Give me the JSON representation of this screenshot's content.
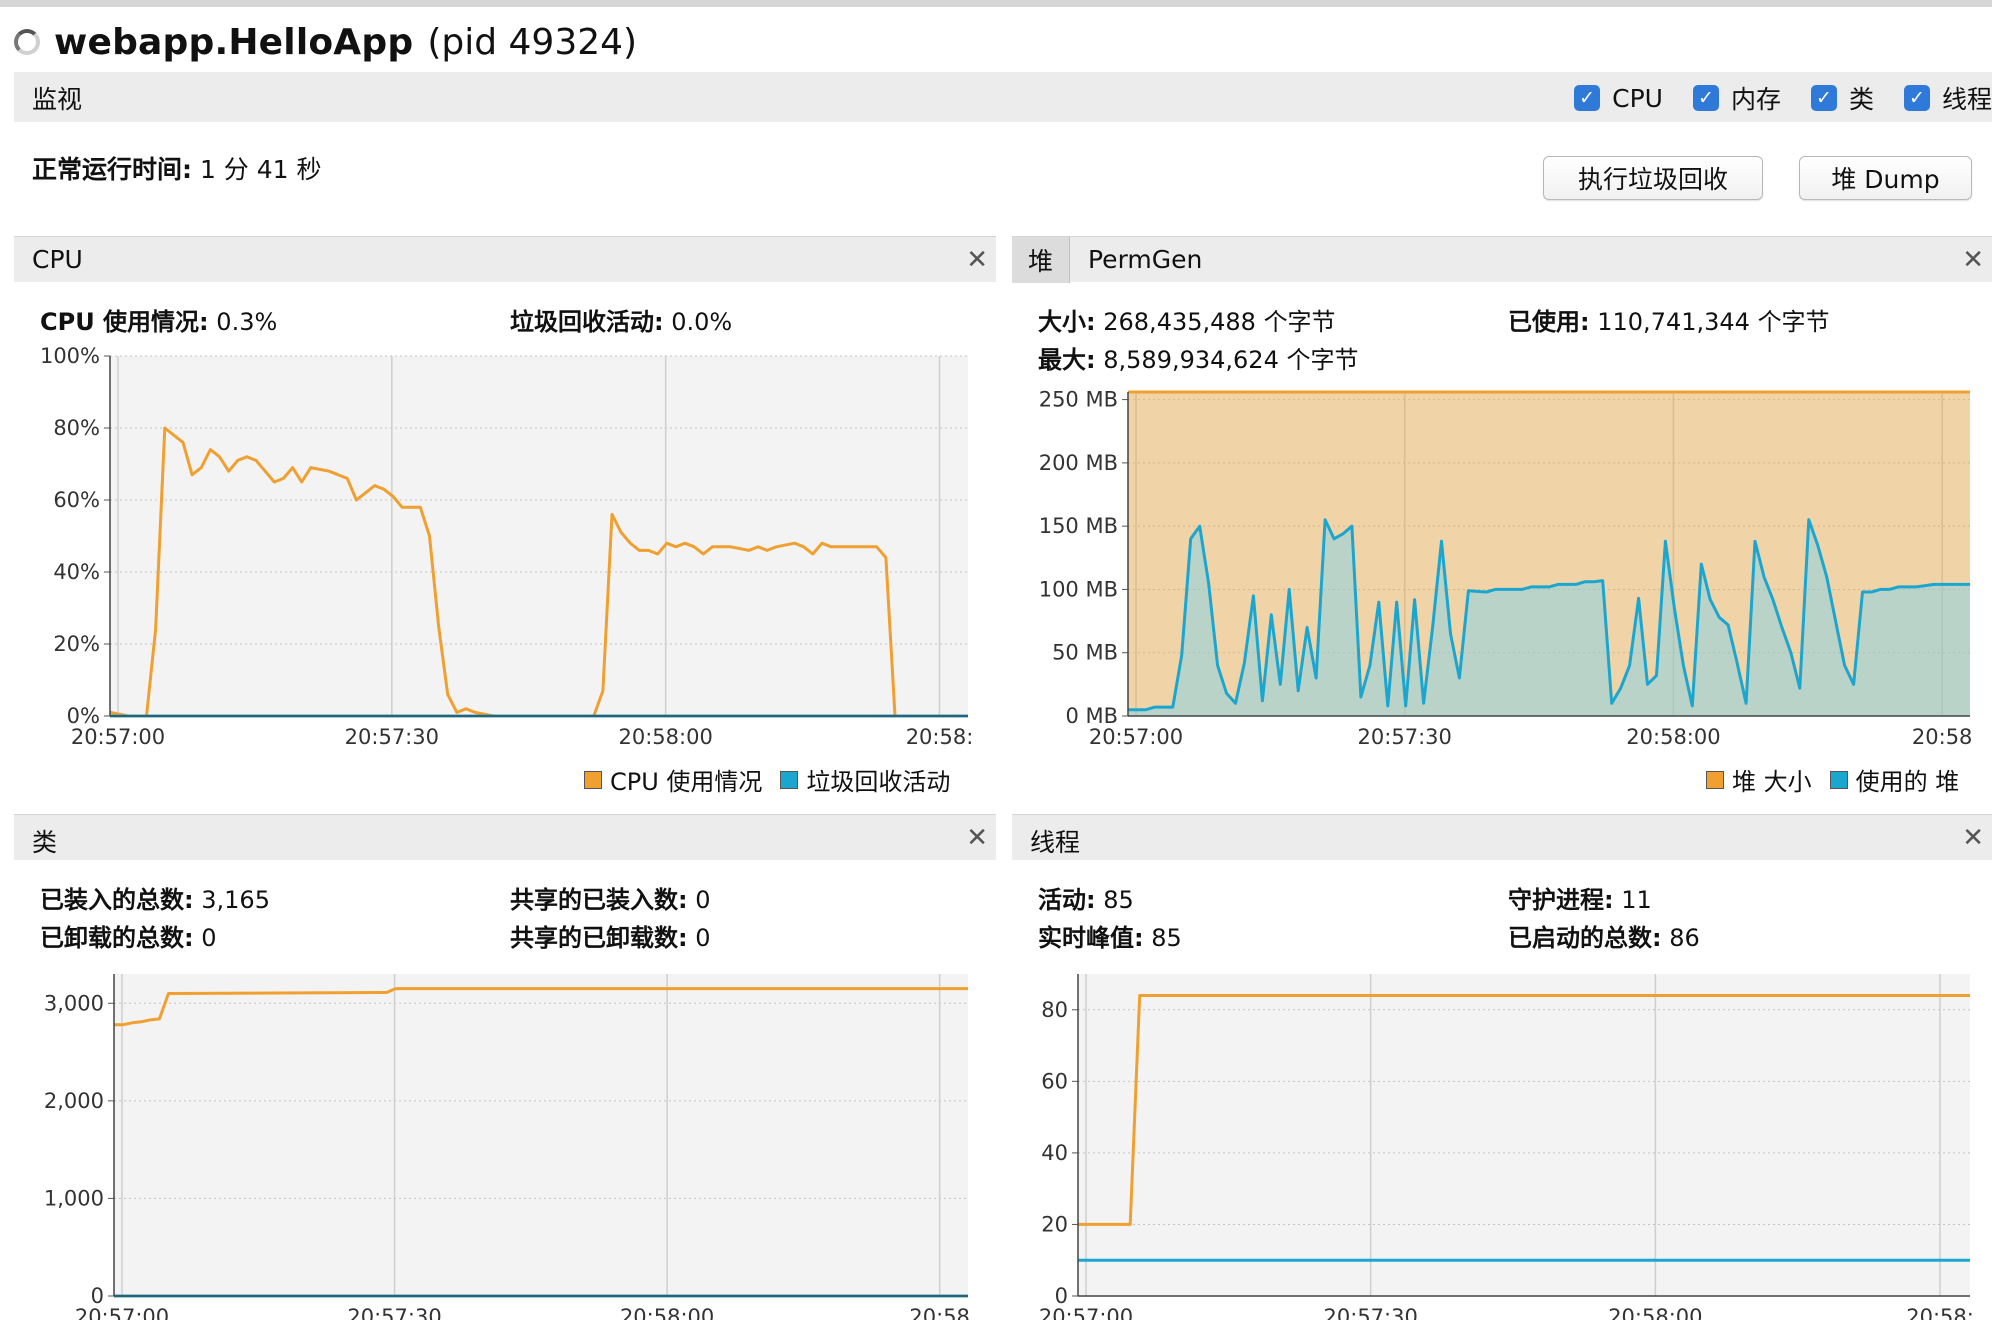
{
  "window": {
    "title": "webapp.HelloApp",
    "pid": "(pid 49324)"
  },
  "monitor": {
    "label": "监视",
    "checks": [
      {
        "label": "CPU",
        "checked": true
      },
      {
        "label": "内存",
        "checked": true
      },
      {
        "label": "类",
        "checked": true
      },
      {
        "label": "线程",
        "checked": true
      }
    ]
  },
  "uptime": {
    "label": "正常运行时间:",
    "value": "1 分 41 秒"
  },
  "buttons": {
    "gc": "执行垃圾回收",
    "heap_dump": "堆 Dump"
  },
  "colors": {
    "orange": "#f0a030",
    "blue": "#1ba6cf",
    "plot_bg": "#f3f3f3"
  },
  "icons": {
    "check": "checkmark-icon",
    "close": "close-icon",
    "spinner": "loading-spinner-icon"
  },
  "cpu_panel": {
    "title": "CPU",
    "usage_label": "CPU 使用情况:",
    "usage_value": "0.3%",
    "gc_label": "垃圾回收活动:",
    "gc_value": "0.0%",
    "legend": [
      "CPU 使用情况",
      "垃圾回收活动"
    ],
    "y_ticks": [
      "100%",
      "80%",
      "60%",
      "40%",
      "20%",
      "0%"
    ],
    "x_ticks": [
      "20:57:00",
      "20:57:30",
      "20:58:00",
      "20:58:"
    ]
  },
  "heap_panel": {
    "tab_active": "堆",
    "tab_other": "PermGen",
    "size_label": "大小:",
    "size_value": "268,435,488 个字节",
    "used_label": "已使用:",
    "used_value": "110,741,344 个字节",
    "max_label": "最大:",
    "max_value": "8,589,934,624 个字节",
    "legend": [
      "堆 大小",
      "使用的 堆"
    ],
    "y_ticks": [
      "250 MB",
      "200 MB",
      "150 MB",
      "100 MB",
      "50 MB",
      "0 MB"
    ],
    "x_ticks": [
      "20:57:00",
      "20:57:30",
      "20:58:00",
      "20:58"
    ]
  },
  "classes_panel": {
    "title": "类",
    "loaded_label": "已装入的总数:",
    "loaded_value": "3,165",
    "shared_loaded_label": "共享的已装入数:",
    "shared_loaded_value": "0",
    "unloaded_label": "已卸载的总数:",
    "unloaded_value": "0",
    "shared_unloaded_label": "共享的已卸载数:",
    "shared_unloaded_value": "0",
    "y_ticks": [
      "3,000",
      "2,000",
      "1,000",
      "0"
    ],
    "x_ticks": [
      "20:57:00",
      "20:57:30",
      "20:58:00",
      "20:58"
    ]
  },
  "threads_panel": {
    "title": "线程",
    "live_label": "活动:",
    "live_value": "85",
    "daemon_label": "守护进程:",
    "daemon_value": "11",
    "peak_label": "实时峰值:",
    "peak_value": "85",
    "started_label": "已启动的总数:",
    "started_value": "86",
    "y_ticks": [
      "80",
      "60",
      "40",
      "20",
      "0"
    ],
    "x_ticks": [
      "20:57:00",
      "20:57:30",
      "20:58:00",
      "20:58:"
    ]
  },
  "chart_data": [
    {
      "type": "line",
      "ylim": [
        0,
        100
      ],
      "xlim": [
        0,
        94
      ],
      "series": [
        {
          "name": "CPU 使用情况",
          "color": "#f0a030",
          "fill": false,
          "points": [
            [
              0,
              1
            ],
            [
              2,
              0
            ],
            [
              4,
              0
            ],
            [
              5,
              24
            ],
            [
              6,
              80
            ],
            [
              8,
              76
            ],
            [
              9,
              67
            ],
            [
              10,
              69
            ],
            [
              11,
              74
            ],
            [
              12,
              72
            ],
            [
              13,
              68
            ],
            [
              14,
              71
            ],
            [
              15,
              72
            ],
            [
              16,
              71
            ],
            [
              17,
              68
            ],
            [
              18,
              65
            ],
            [
              19,
              66
            ],
            [
              20,
              69
            ],
            [
              21,
              65
            ],
            [
              22,
              69
            ],
            [
              24,
              68
            ],
            [
              26,
              66
            ],
            [
              27,
              60
            ],
            [
              28,
              62
            ],
            [
              29,
              64
            ],
            [
              30,
              63
            ],
            [
              31,
              61
            ],
            [
              32,
              58
            ],
            [
              34,
              58
            ],
            [
              35,
              50
            ],
            [
              36,
              25
            ],
            [
              37,
              6
            ],
            [
              38,
              1
            ],
            [
              39,
              2
            ],
            [
              40,
              1
            ],
            [
              42,
              0
            ],
            [
              53,
              0
            ],
            [
              54,
              7
            ],
            [
              55,
              56
            ],
            [
              56,
              51
            ],
            [
              57,
              48
            ],
            [
              58,
              46
            ],
            [
              59,
              46
            ],
            [
              60,
              45
            ],
            [
              61,
              48
            ],
            [
              62,
              47
            ],
            [
              63,
              48
            ],
            [
              64,
              47
            ],
            [
              65,
              45
            ],
            [
              66,
              47
            ],
            [
              68,
              47
            ],
            [
              70,
              46
            ],
            [
              71,
              47
            ],
            [
              72,
              46
            ],
            [
              73,
              47
            ],
            [
              75,
              48
            ],
            [
              76,
              47
            ],
            [
              77,
              45
            ],
            [
              78,
              48
            ],
            [
              79,
              47
            ],
            [
              81,
              47
            ],
            [
              82,
              47
            ],
            [
              83,
              47
            ],
            [
              84,
              47
            ],
            [
              85,
              44
            ],
            [
              86,
              0
            ]
          ]
        },
        {
          "name": "垃圾回收活动",
          "color": "#1ba6cf",
          "fill": false,
          "points": [
            [
              0,
              0
            ],
            [
              94,
              0
            ]
          ]
        }
      ]
    },
    {
      "type": "area",
      "ylim": [
        0,
        256
      ],
      "xlim": [
        0,
        94
      ],
      "series": [
        {
          "name": "堆 大小",
          "color": "#f0a030",
          "fill": true,
          "points": [
            [
              0,
              256
            ],
            [
              94,
              256
            ]
          ]
        },
        {
          "name": "使用的 堆",
          "color": "#1ba6cf",
          "fill": true,
          "points": [
            [
              0,
              5
            ],
            [
              2,
              5
            ],
            [
              3,
              7
            ],
            [
              5,
              7
            ],
            [
              6,
              48
            ],
            [
              7,
              140
            ],
            [
              8,
              150
            ],
            [
              9,
              105
            ],
            [
              10,
              40
            ],
            [
              11,
              18
            ],
            [
              12,
              10
            ],
            [
              13,
              42
            ],
            [
              14,
              95
            ],
            [
              15,
              12
            ],
            [
              16,
              80
            ],
            [
              17,
              25
            ],
            [
              18,
              100
            ],
            [
              19,
              20
            ],
            [
              20,
              70
            ],
            [
              21,
              30
            ],
            [
              22,
              155
            ],
            [
              23,
              140
            ],
            [
              24,
              144
            ],
            [
              25,
              150
            ],
            [
              26,
              15
            ],
            [
              27,
              40
            ],
            [
              28,
              90
            ],
            [
              29,
              8
            ],
            [
              30,
              90
            ],
            [
              31,
              8
            ],
            [
              32,
              92
            ],
            [
              33,
              10
            ],
            [
              34,
              70
            ],
            [
              35,
              138
            ],
            [
              36,
              65
            ],
            [
              37,
              30
            ],
            [
              38,
              99
            ],
            [
              40,
              98
            ],
            [
              41,
              100
            ],
            [
              42,
              100
            ],
            [
              44,
              100
            ],
            [
              45,
              102
            ],
            [
              47,
              102
            ],
            [
              48,
              104
            ],
            [
              50,
              104
            ],
            [
              51,
              106
            ],
            [
              52,
              106
            ],
            [
              53,
              107
            ],
            [
              54,
              10
            ],
            [
              55,
              22
            ],
            [
              56,
              40
            ],
            [
              57,
              93
            ],
            [
              58,
              25
            ],
            [
              59,
              32
            ],
            [
              60,
              138
            ],
            [
              61,
              85
            ],
            [
              62,
              40
            ],
            [
              63,
              8
            ],
            [
              64,
              120
            ],
            [
              65,
              92
            ],
            [
              66,
              78
            ],
            [
              67,
              72
            ],
            [
              68,
              42
            ],
            [
              69,
              10
            ],
            [
              70,
              138
            ],
            [
              71,
              110
            ],
            [
              72,
              92
            ],
            [
              73,
              70
            ],
            [
              74,
              50
            ],
            [
              75,
              22
            ],
            [
              76,
              155
            ],
            [
              77,
              135
            ],
            [
              78,
              110
            ],
            [
              79,
              75
            ],
            [
              80,
              40
            ],
            [
              81,
              25
            ],
            [
              82,
              98
            ],
            [
              83,
              98
            ],
            [
              84,
              100
            ],
            [
              85,
              100
            ],
            [
              86,
              102
            ],
            [
              88,
              102
            ],
            [
              90,
              104
            ],
            [
              92,
              104
            ],
            [
              94,
              104
            ]
          ]
        }
      ]
    },
    {
      "type": "line",
      "ylim": [
        0,
        3300
      ],
      "xlim": [
        0,
        94
      ],
      "series": [
        {
          "name": "已装入的总数",
          "color": "#f0a030",
          "fill": false,
          "points": [
            [
              0,
              2780
            ],
            [
              1,
              2780
            ],
            [
              2,
              2800
            ],
            [
              3,
              2810
            ],
            [
              4,
              2830
            ],
            [
              5,
              2840
            ],
            [
              6,
              3100
            ],
            [
              30,
              3110
            ],
            [
              31,
              3150
            ],
            [
              94,
              3150
            ]
          ]
        },
        {
          "name": "共享的已装入数",
          "color": "#1ba6cf",
          "fill": false,
          "points": [
            [
              0,
              0
            ],
            [
              94,
              0
            ]
          ]
        }
      ]
    },
    {
      "type": "line",
      "ylim": [
        0,
        90
      ],
      "xlim": [
        0,
        94
      ],
      "series": [
        {
          "name": "实时峰值",
          "color": "#f0a030",
          "fill": false,
          "points": [
            [
              0,
              20
            ],
            [
              5.5,
              20
            ],
            [
              6.5,
              84
            ],
            [
              94,
              84
            ]
          ]
        },
        {
          "name": "守护进程",
          "color": "#1ba6cf",
          "fill": false,
          "points": [
            [
              0,
              10
            ],
            [
              94,
              10
            ]
          ]
        }
      ]
    }
  ]
}
